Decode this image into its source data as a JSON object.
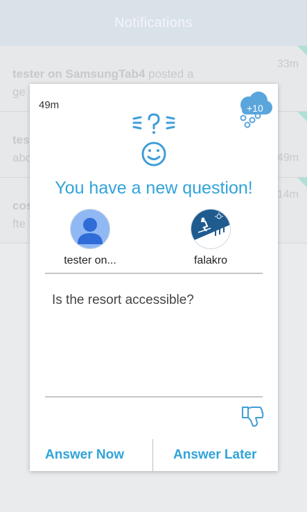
{
  "header": {
    "title": "Notifications"
  },
  "notifications": [
    {
      "time": "33m",
      "user": "tester on SamsungTab4",
      "text_after": " posted a",
      "line2": "ge"
    },
    {
      "time": "49m",
      "user": "tes",
      "text_after": "",
      "line2": "abo"
    },
    {
      "time": "14m",
      "user": "cos",
      "text_after": "",
      "line2": "fte"
    }
  ],
  "dialog": {
    "time": "49m",
    "points": "+10",
    "title": "You have a new question!",
    "asker_name": "tester on...",
    "resort_name": "falakro",
    "question": "Is the resort accessible?",
    "answer_now": "Answer Now",
    "answer_later": "Answer Later"
  },
  "colors": {
    "accent": "#31a3d9",
    "header_bg": "#d9e1e9",
    "corner": "#aee0d7"
  },
  "icons": [
    "question-face-icon",
    "points-cloud-icon",
    "user-avatar-icon",
    "skier-icon",
    "thumbs-down-icon"
  ]
}
